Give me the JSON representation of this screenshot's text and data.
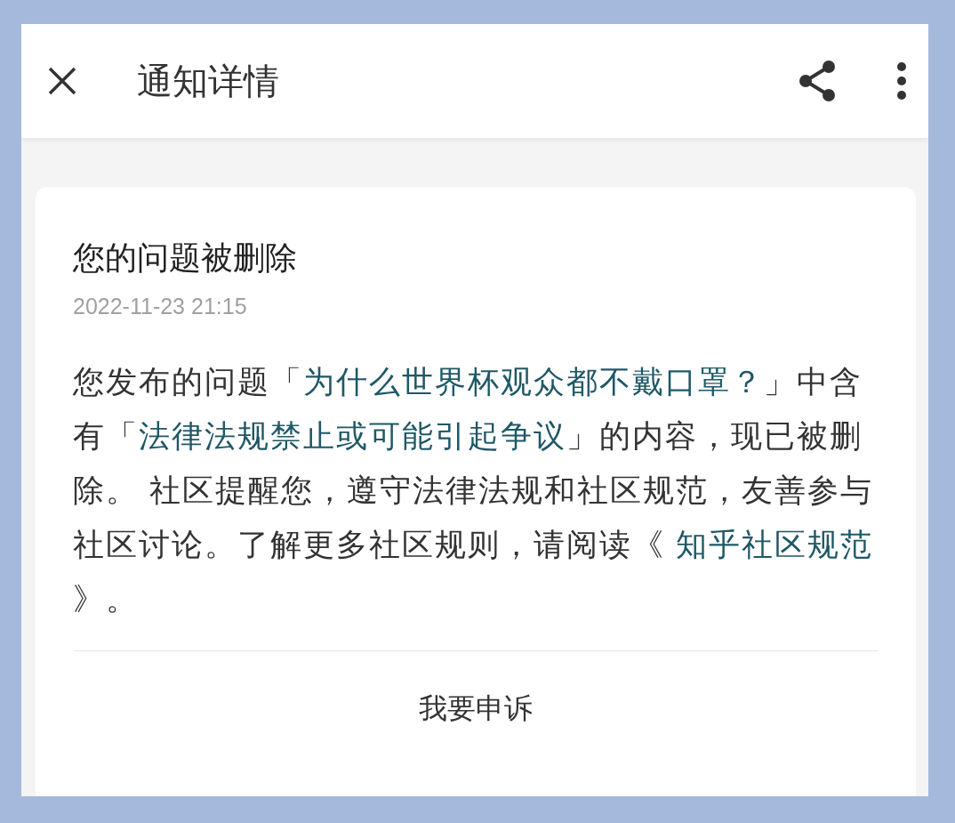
{
  "header": {
    "title": "通知详情"
  },
  "notice": {
    "title": "您的问题被删除",
    "time": "2022-11-23 21:15",
    "body": [
      {
        "kind": "plain",
        "text": "您发布的问题「"
      },
      {
        "kind": "highlight",
        "text": "为什么世界杯观众都不戴口罩？"
      },
      {
        "kind": "plain",
        "text": "」中含有「"
      },
      {
        "kind": "highlight",
        "text": "法律法规禁止或可能引起争议"
      },
      {
        "kind": "plain",
        "text": "」的内容，现已被删除。 社区提醒您，遵守法律法规和社区规范，友善参与社区讨论。了解更多社区规则，请阅读《 "
      },
      {
        "kind": "link",
        "text": "知乎社区规范"
      },
      {
        "kind": "plain",
        "text": " 》。"
      }
    ],
    "action": "我要申诉"
  }
}
